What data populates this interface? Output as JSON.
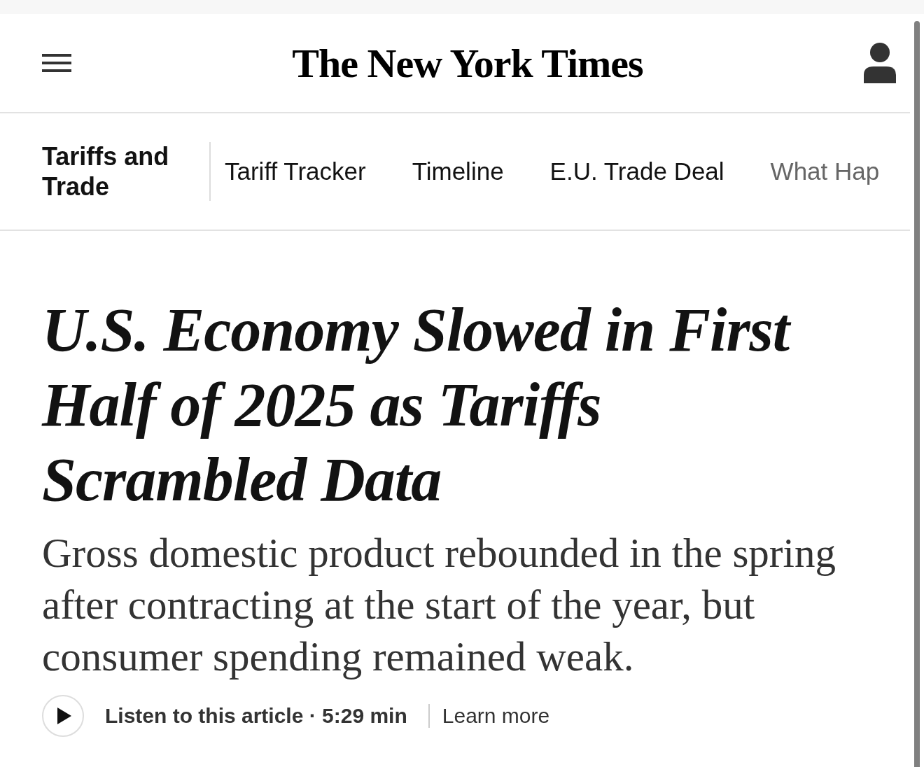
{
  "header": {
    "logo": "The New York Times"
  },
  "section_nav": {
    "title": "Tariffs and Trade",
    "links": [
      {
        "label": "Tariff Tracker",
        "faded": false
      },
      {
        "label": "Timeline",
        "faded": false
      },
      {
        "label": "E.U. Trade Deal",
        "faded": false
      },
      {
        "label": "What Hap",
        "faded": true
      }
    ]
  },
  "article": {
    "headline": "U.S. Economy Slowed in First Half of 2025 as Tariffs Scrambled Data",
    "summary": "Gross domestic product rebounded in the spring after contracting at the start of the year, but consumer spending remained weak.",
    "listen": "Listen to this article · 5:29 min",
    "learn_more": "Learn more"
  }
}
